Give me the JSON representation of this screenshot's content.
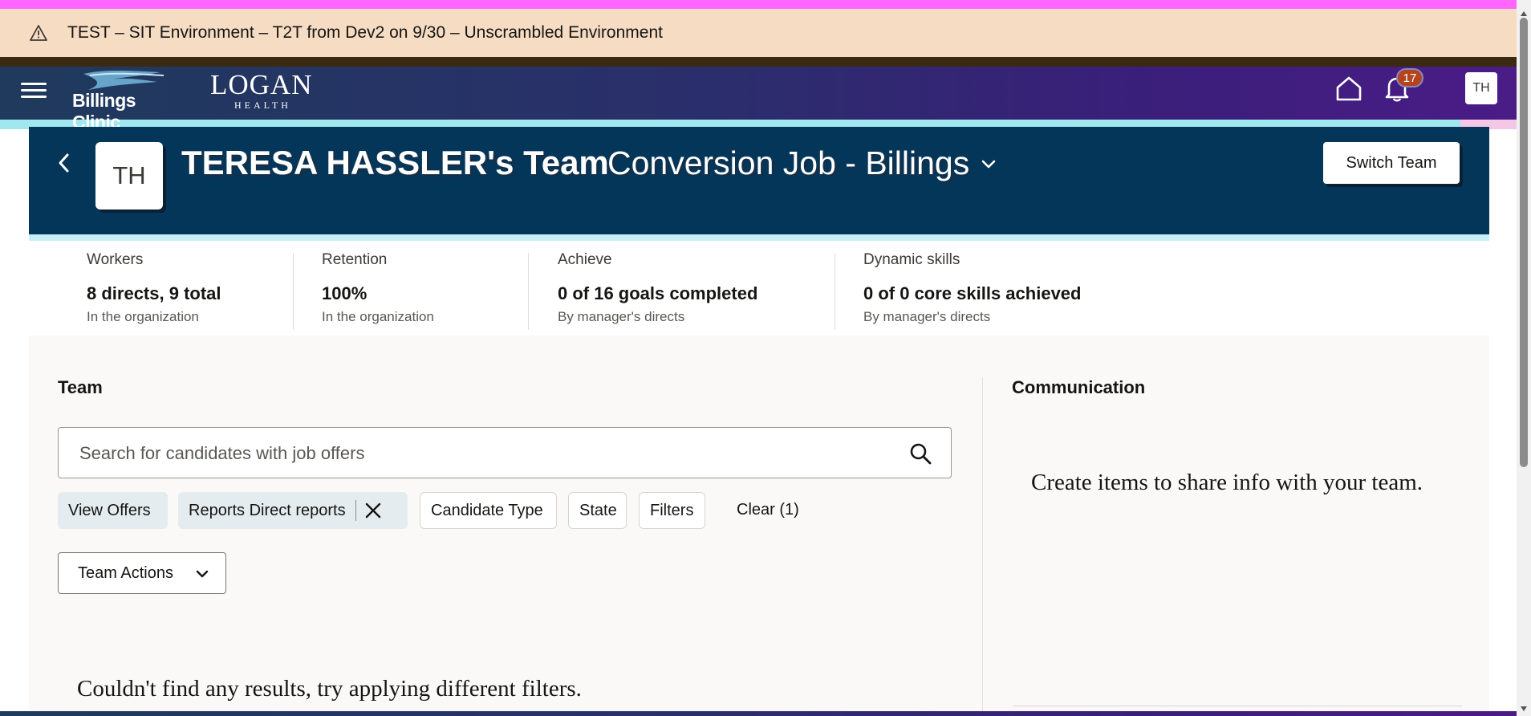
{
  "environment_banner": {
    "text": "TEST – SIT Environment – T2T from Dev2 on 9/30 – Unscrambled Environment",
    "icon": "warning-icon"
  },
  "header": {
    "menu_icon": "hamburger-icon",
    "logo_billings": "Billings Clinic",
    "logo_logan_main": "LOGAN",
    "logo_logan_sub": "HEALTH",
    "home_icon": "home-icon",
    "bell_icon": "bell-icon",
    "notification_count": "17",
    "user_initials": "TH"
  },
  "team_banner": {
    "avatar_initials": "TH",
    "title": "TERESA HASSLER's Team",
    "subtitle": "Conversion Job - Billings",
    "switch_team_label": "Switch Team"
  },
  "stats": [
    {
      "label": "Workers",
      "value": "8 directs, 9 total",
      "sub": "In the organization"
    },
    {
      "label": "Retention",
      "value": "100%",
      "sub": "In the organization"
    },
    {
      "label": "Achieve",
      "value": "0 of 16 goals completed",
      "sub": "By manager's directs"
    },
    {
      "label": "Dynamic skills",
      "value": "0 of 0 core skills achieved",
      "sub": "By manager's directs"
    }
  ],
  "team": {
    "title": "Team",
    "search_placeholder": "Search for candidates with job offers",
    "chips": {
      "view": "View Offers",
      "reports": "Reports Direct reports",
      "candidate_type": "Candidate Type",
      "state": "State",
      "filters": "Filters"
    },
    "clear_label": "Clear (1)",
    "team_actions_label": "Team Actions",
    "no_results": "Couldn't find any results, try applying different filters."
  },
  "communication": {
    "title": "Communication",
    "text": "Create items to share info with your team."
  },
  "colors": {
    "banner_bg": "#f6dcc2",
    "header_start": "#1f3a5c",
    "header_end": "#4a1c86",
    "team_banner": "#04365a",
    "badge": "#b2451f"
  }
}
